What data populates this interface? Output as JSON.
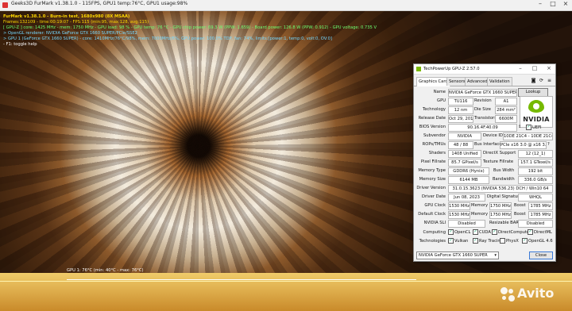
{
  "furmark_window": {
    "title": "Geeks3D FurMark v1.38.1.0 - 115FPS, GPU1 temp:76°C, GPU1 usage:98%"
  },
  "overlay": {
    "line1": "FurMark v1.38.1.0 - Burn-in test, 1680x980 (8X MSAA)",
    "line2": "Frames:132109 - time:00:19:07 - FPS:115 (min:95, max:128, avg:115)",
    "line3": "[ GPU-Z ] core: 1425 MHz - mem: 1750 MHz - GPU load: 98 % - GPU temp: 76 °C - GPU chip power: 69.3 W (PPW: 1.659) - Board power: 126.8 W (PPW: 0.912) - GPU voltage: 0.735 V",
    "line4": "> OpenGL renderer: NVIDIA GeForce GTX 1660 SUPER/PCIe/SSE2",
    "line5": "> GPU 1 (GeForce GTX 1660 SUPER) - core: 1410MHz/76°C/98%, mem: 7000MHz/6%, GPU power: 100.0% TDP, fan: 74%, limits:[power:1, temp:0, volt:0, OV:0]",
    "line6": "- F1: toggle help",
    "temp_graph_label": "GPU 1: 76°C (min: 40°C - max: 76°C)"
  },
  "gpuz": {
    "title": "TechPowerUp GPU-Z 2.57.0",
    "tabs": [
      "Graphics Card",
      "Sensors",
      "Advanced",
      "Validation"
    ],
    "labels": {
      "name": "Name",
      "gpu": "GPU",
      "revision": "Revision",
      "technology": "Technology",
      "die_size": "Die Size",
      "release_date": "Release Date",
      "transistors": "Transistors",
      "bios": "BIOS Version",
      "subvendor": "Subvendor",
      "device_id": "Device ID",
      "rops": "ROPs/TMUs",
      "bus_interface": "Bus Interface",
      "shaders": "Shaders",
      "directx": "DirectX Support",
      "pixel_fillrate": "Pixel Fillrate",
      "texture_fillrate": "Texture Fillrate",
      "memory_type": "Memory Type",
      "bus_width": "Bus Width",
      "memory_size": "Memory Size",
      "bandwidth": "Bandwidth",
      "driver_version": "Driver Version",
      "driver_date": "Driver Date",
      "digital_signature": "Digital Signature",
      "gpu_clock": "GPU Clock",
      "memory": "Memory",
      "boost": "Boost",
      "default_clock": "Default Clock",
      "nvidia_sli": "NVIDIA SLI",
      "resizable_bar": "Resizable BAR",
      "computing": "Computing",
      "technologies": "Technologies"
    },
    "values": {
      "name": "NVIDIA GeForce GTX 1660 SUPER",
      "lookup": "Lookup",
      "gpu": "TU116",
      "revision": "A1",
      "technology": "12 nm",
      "die_size": "284 mm²",
      "release_date": "Oct 29, 2019",
      "transistors": "6600M",
      "bios": "90.16.4F.40.09",
      "uefi": "UEFI",
      "subvendor": "NVIDIA",
      "device_id": "10DE 21C4 - 10DE 21C4",
      "rops": "48 / 88",
      "bus_interface": "PCIe x16 3.0 @ x16 3.0",
      "shaders": "1408 Unified",
      "directx": "12 (12_1)",
      "pixel_fillrate": "85.7 GPixel/s",
      "texture_fillrate": "157.1 GTexel/s",
      "memory_type": "GDDR6 (Hynix)",
      "bus_width": "192 bit",
      "memory_size": "6144 MB",
      "bandwidth": "336.0 GB/s",
      "driver_version": "31.0.15.3623 (NVIDIA 536.23) DCH / Win10 64",
      "driver_date": "Jun 08, 2023",
      "digital_signature": "WHQL",
      "gpu_clock": "1530 MHz",
      "gpu_memory": "1750 MHz",
      "gpu_boost": "1785 MHz",
      "default_clock": "1530 MHz",
      "default_memory": "1750 MHz",
      "default_boost": "1785 MHz",
      "nvidia_sli": "Disabled",
      "resizable_bar": "Disabled"
    },
    "computing": [
      "OpenCL",
      "CUDA",
      "DirectCompute",
      "DirectML"
    ],
    "technologies": [
      "Vulkan",
      "Ray Tracing",
      "PhysX",
      "OpenGL 4.6"
    ],
    "logo_text": "NVIDIA",
    "selected_gpu": "NVIDIA GeForce GTX 1660 SUPER",
    "close_label": "Close"
  },
  "watermark": "Avito",
  "colors": {
    "nvidia_green": "#76b900",
    "overlay_yellow": "#ffd800",
    "overlay_green": "#6cff70",
    "overlay_cyan": "#74d8ff"
  }
}
